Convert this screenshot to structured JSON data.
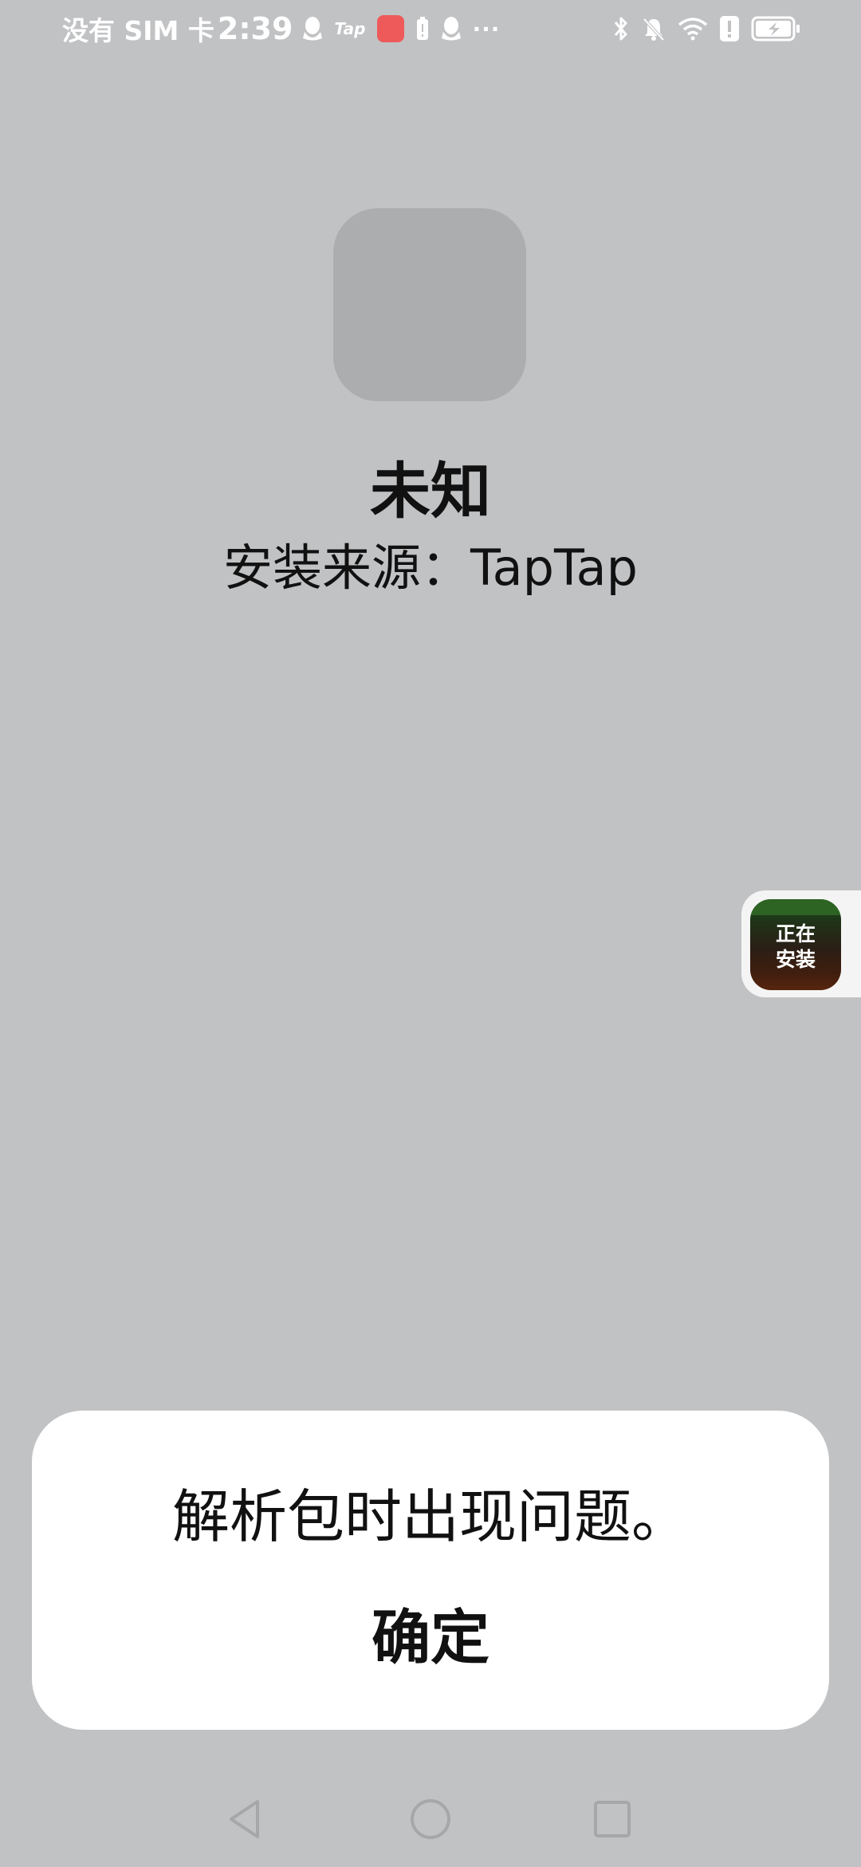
{
  "status_bar": {
    "carrier": "没有 SIM 卡",
    "time": "2:39",
    "notification_icons": [
      "qq-icon",
      "taptap-icon",
      "huawei-store-icon",
      "battery-alert-icon",
      "qq-icon",
      "more-dots-icon"
    ],
    "tap_text": "Tap",
    "more_dots": "···",
    "system_icons": [
      "bluetooth-icon",
      "mute-icon",
      "wifi-icon",
      "alert-icon",
      "battery-charging-icon"
    ]
  },
  "app": {
    "name": "未知",
    "install_source": "安装来源：TapTap"
  },
  "installing_badge": {
    "label_line1": "正在",
    "label_line2": "安装"
  },
  "dialog": {
    "message": "解析包时出现问题。",
    "confirm_label": "确定"
  },
  "nav_bar": {
    "buttons": [
      "back-icon",
      "home-icon",
      "recents-icon"
    ]
  }
}
